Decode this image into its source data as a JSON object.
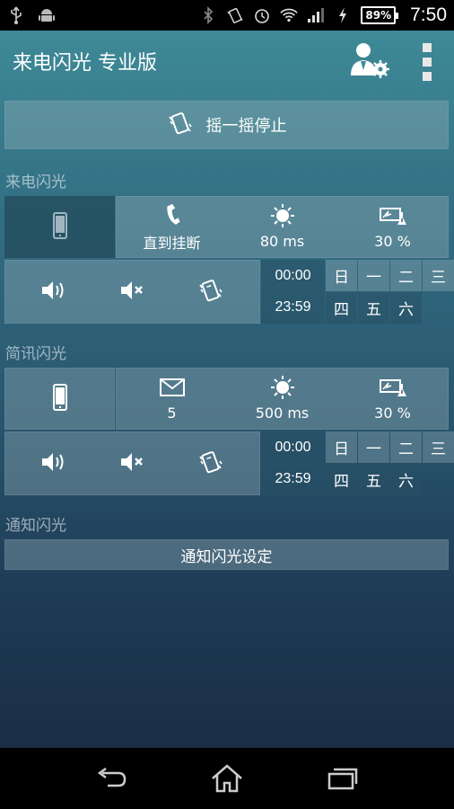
{
  "status_bar": {
    "battery": "89%",
    "time": "7:50"
  },
  "app": {
    "title": "来电闪光 专业版"
  },
  "shake_button": {
    "label": "摇一摇停止"
  },
  "call_section": {
    "label": "来电闪光",
    "duration": "直到挂断",
    "flash_speed": "80 ms",
    "battery_threshold": "30 %",
    "time_start": "00:00",
    "time_end": "23:59",
    "days": [
      {
        "label": "日",
        "on": true
      },
      {
        "label": "一",
        "on": true
      },
      {
        "label": "二",
        "on": true
      },
      {
        "label": "三",
        "on": true
      },
      {
        "label": "四",
        "on": false
      },
      {
        "label": "五",
        "on": false
      },
      {
        "label": "六",
        "on": false
      }
    ]
  },
  "sms_section": {
    "label": "简讯闪光",
    "count": "5",
    "flash_speed": "500 ms",
    "battery_threshold": "30 %",
    "time_start": "00:00",
    "time_end": "23:59",
    "days": [
      {
        "label": "日",
        "on": true
      },
      {
        "label": "一",
        "on": true
      },
      {
        "label": "二",
        "on": true
      },
      {
        "label": "三",
        "on": true
      },
      {
        "label": "四",
        "on": false
      },
      {
        "label": "五",
        "on": false
      },
      {
        "label": "六",
        "on": false
      }
    ]
  },
  "notify_section": {
    "label": "通知闪光",
    "button_label": "通知闪光设定"
  },
  "icons": [
    "usb-icon",
    "android-icon",
    "bluetooth-icon",
    "vibrate-icon",
    "alarm-icon",
    "wifi-icon",
    "signal-icon",
    "charging-icon",
    "user-settings-icon",
    "overflow-menu-icon",
    "shake-phone-icon",
    "phone-icon",
    "phone-call-icon",
    "brightness-icon",
    "battery-warning-icon",
    "sound-on-icon",
    "mute-icon",
    "vibrate-icon",
    "mail-icon",
    "back-icon",
    "home-icon",
    "recent-apps-icon"
  ]
}
